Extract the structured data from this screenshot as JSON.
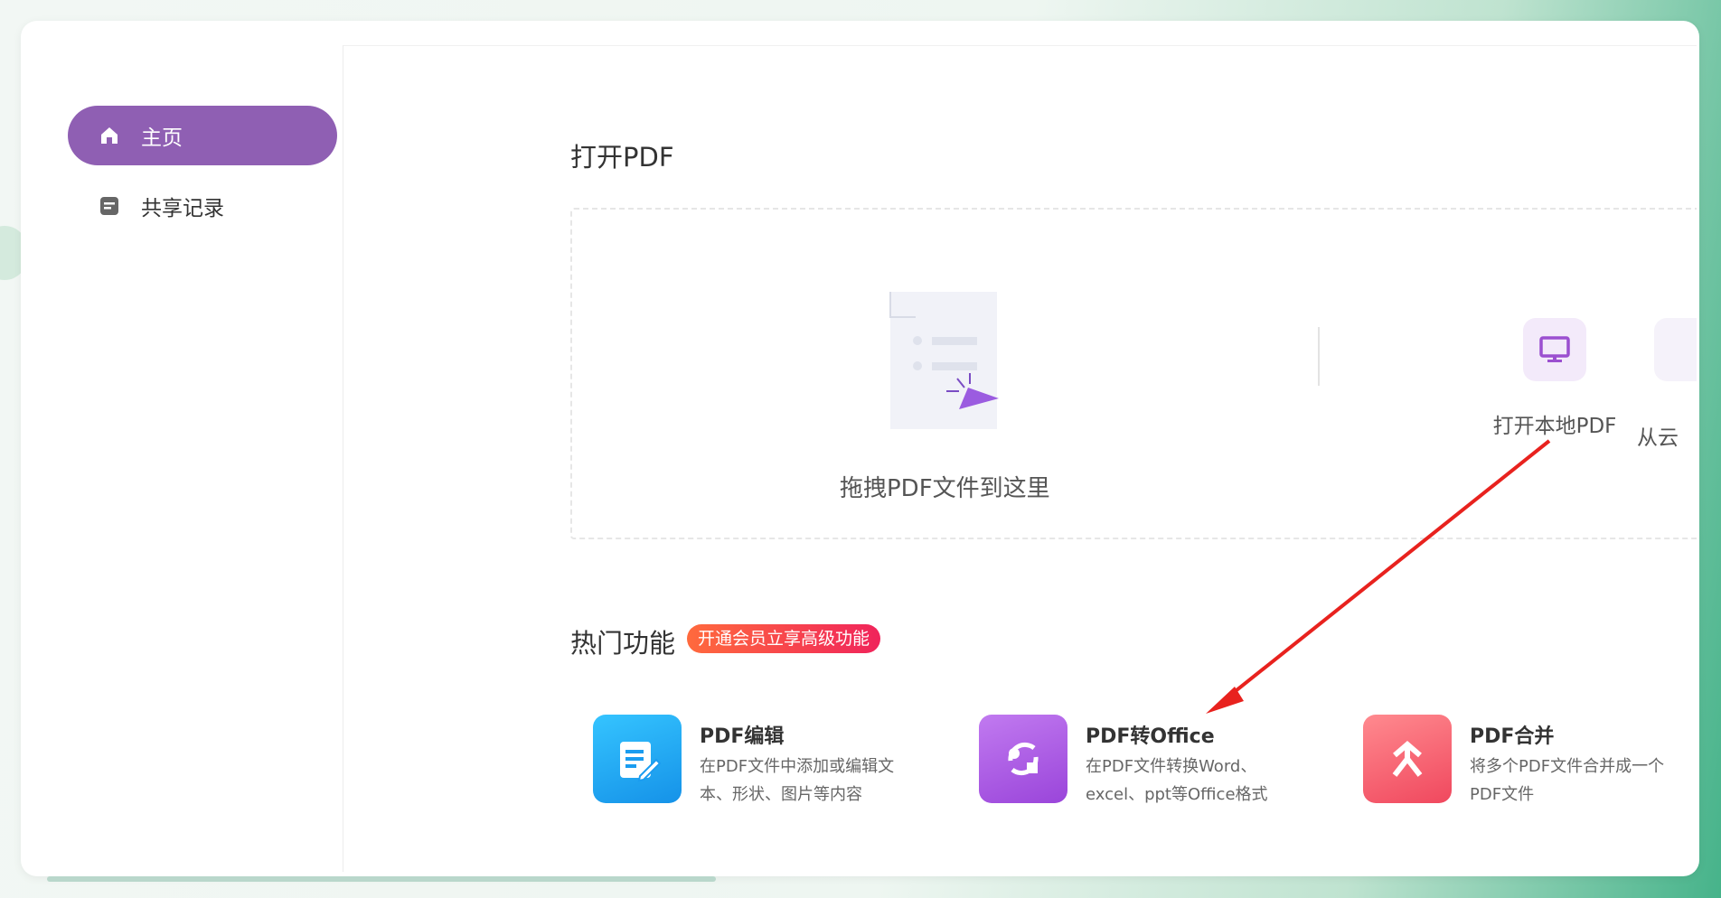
{
  "sidebar": {
    "items": [
      {
        "label": "主页",
        "icon": "home-icon",
        "active": true
      },
      {
        "label": "共享记录",
        "icon": "document-icon",
        "active": false
      }
    ]
  },
  "main": {
    "open_section_title": "打开PDF",
    "drop_zone": {
      "text": "拖拽PDF文件到这里"
    },
    "open_local_label": "打开本地PDF",
    "cloud_label": "从云",
    "hot_section_title": "热门功能",
    "promo_badge": "开通会员立享高级功能",
    "features": [
      {
        "title": "PDF编辑",
        "desc": "在PDF文件中添加或编辑文本、形状、图片等内容",
        "color": "#1ea0f0"
      },
      {
        "title": "PDF转Office",
        "desc": "在PDF文件转换Word、excel、ppt等Office格式",
        "color": "#a552dc"
      },
      {
        "title": "PDF合并",
        "desc": "将多个PDF文件合并成一个PDF文件",
        "color": "#f2556a"
      }
    ]
  },
  "colors": {
    "accent": "#8f5fb3",
    "annotation_arrow": "#e8221e"
  }
}
